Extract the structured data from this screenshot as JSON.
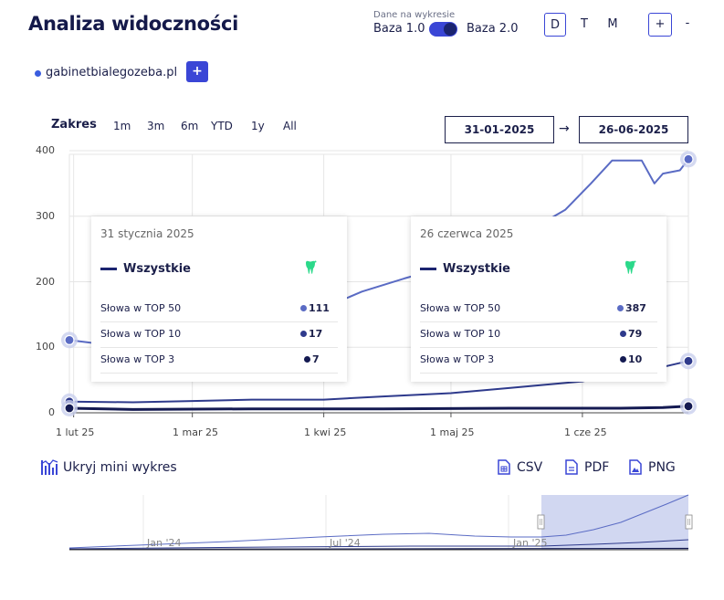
{
  "header": {
    "title": "Analiza widoczności",
    "toggle_caption": "Dane na wykresie",
    "base_left": "Baza 1.0",
    "base_right": "Baza 2.0",
    "periods": [
      "D",
      "T",
      "M"
    ],
    "zoom_in": "+",
    "zoom_out": "-"
  },
  "domain": {
    "name": "gabinetbialegozeba.pl",
    "add_label": "+"
  },
  "range": {
    "label": "Zakres",
    "options": [
      "1m",
      "3m",
      "6m",
      "YTD",
      "1y",
      "All"
    ],
    "from": "31-01-2025",
    "arrow": "→",
    "to": "26-06-2025"
  },
  "tooltips": [
    {
      "date": "31 stycznia 2025",
      "series": "Wszystkie",
      "rows": [
        {
          "label": "Słowa w TOP 50",
          "value": "111"
        },
        {
          "label": "Słowa w TOP 10",
          "value": "17"
        },
        {
          "label": "Słowa w TOP 3",
          "value": "7"
        }
      ]
    },
    {
      "date": "26 czerwca 2025",
      "series": "Wszystkie",
      "rows": [
        {
          "label": "Słowa w TOP 50",
          "value": "387"
        },
        {
          "label": "Słowa w TOP 10",
          "value": "79"
        },
        {
          "label": "Słowa w TOP 3",
          "value": "10"
        }
      ]
    }
  ],
  "footer": {
    "mini_toggle": "Ukryj mini wykres",
    "exports": [
      "CSV",
      "PDF",
      "PNG"
    ],
    "mini_labels": [
      "Jan '24",
      "Jul '24",
      "Jan '25"
    ]
  },
  "colors": {
    "accent": "#3a46d6",
    "top50": "#5a6bc4",
    "top10": "#2e3a8c",
    "top3": "#141a52"
  },
  "chart_data": {
    "type": "line",
    "ylim": [
      0,
      400
    ],
    "yticks": [
      0,
      100,
      200,
      300,
      400
    ],
    "xtick_labels": [
      "1 lut 25",
      "1 mar 25",
      "1 kwi 25",
      "1 maj 25",
      "1 cze 25"
    ],
    "xtick_dates": [
      "2025-02-01",
      "2025-03-01",
      "2025-04-01",
      "2025-05-01",
      "2025-06-01"
    ],
    "x_start": "2025-01-31",
    "x_end": "2025-06-26",
    "grid": true,
    "series": [
      {
        "name": "Słowa w TOP 50",
        "color": "#5a6bc4",
        "points": [
          [
            "2025-01-31",
            111
          ],
          [
            "2025-02-05",
            107
          ],
          [
            "2025-02-15",
            105
          ],
          [
            "2025-03-01",
            112
          ],
          [
            "2025-03-15",
            130
          ],
          [
            "2025-04-01",
            160
          ],
          [
            "2025-04-10",
            185
          ],
          [
            "2025-04-20",
            205
          ],
          [
            "2025-05-01",
            225
          ],
          [
            "2025-05-10",
            250
          ],
          [
            "2025-05-20",
            280
          ],
          [
            "2025-05-28",
            310
          ],
          [
            "2025-06-03",
            350
          ],
          [
            "2025-06-08",
            385
          ],
          [
            "2025-06-15",
            385
          ],
          [
            "2025-06-18",
            350
          ],
          [
            "2025-06-20",
            365
          ],
          [
            "2025-06-24",
            370
          ],
          [
            "2025-06-26",
            387
          ]
        ]
      },
      {
        "name": "Słowa w TOP 10",
        "color": "#2e3a8c",
        "points": [
          [
            "2025-01-31",
            17
          ],
          [
            "2025-02-15",
            16
          ],
          [
            "2025-03-01",
            18
          ],
          [
            "2025-03-15",
            20
          ],
          [
            "2025-04-01",
            20
          ],
          [
            "2025-04-15",
            25
          ],
          [
            "2025-05-01",
            30
          ],
          [
            "2025-05-15",
            38
          ],
          [
            "2025-06-01",
            48
          ],
          [
            "2025-06-10",
            62
          ],
          [
            "2025-06-20",
            70
          ],
          [
            "2025-06-26",
            79
          ]
        ]
      },
      {
        "name": "Słowa w TOP 3",
        "color": "#141a52",
        "points": [
          [
            "2025-01-31",
            7
          ],
          [
            "2025-02-15",
            5
          ],
          [
            "2025-03-15",
            6
          ],
          [
            "2025-04-15",
            6
          ],
          [
            "2025-05-15",
            7
          ],
          [
            "2025-06-10",
            7
          ],
          [
            "2025-06-20",
            8
          ],
          [
            "2025-06-26",
            10
          ]
        ]
      }
    ]
  }
}
